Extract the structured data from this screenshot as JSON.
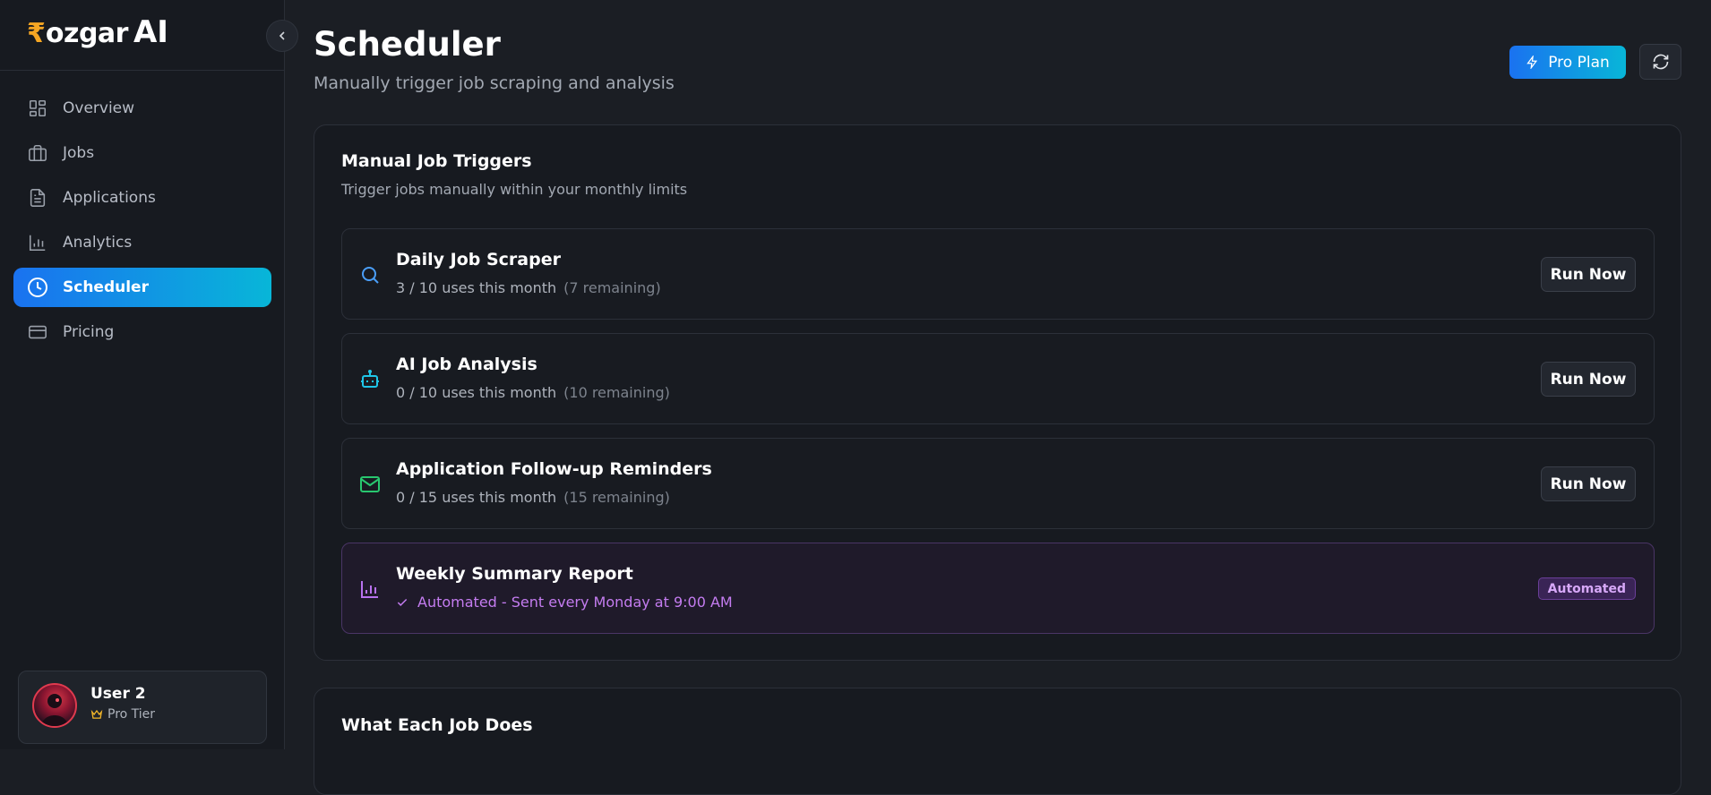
{
  "brand": {
    "rupee": "₹",
    "name": "ozgar",
    "ai": "AI"
  },
  "sidebar": {
    "items": [
      {
        "label": "Overview",
        "icon": "grid-icon",
        "active": false
      },
      {
        "label": "Jobs",
        "icon": "briefcase-icon",
        "active": false
      },
      {
        "label": "Applications",
        "icon": "document-icon",
        "active": false
      },
      {
        "label": "Analytics",
        "icon": "bar-chart-icon",
        "active": false
      },
      {
        "label": "Scheduler",
        "icon": "clock-icon",
        "active": true
      },
      {
        "label": "Pricing",
        "icon": "credit-card-icon",
        "active": false
      }
    ],
    "user": {
      "name": "User 2",
      "tier": "Pro Tier"
    }
  },
  "header": {
    "title": "Scheduler",
    "subtitle": "Manually trigger job scraping and analysis",
    "plan_label": "Pro Plan"
  },
  "triggers": {
    "title": "Manual Job Triggers",
    "subtitle": "Trigger jobs manually within your monthly limits",
    "jobs": [
      {
        "name": "Daily Job Scraper",
        "usage": "3 / 10 uses this month",
        "remaining": "(7 remaining)",
        "button": "Run Now",
        "icon": "search-icon",
        "color": "#4a9ef8"
      },
      {
        "name": "AI Job Analysis",
        "usage": "0 / 10 uses this month",
        "remaining": "(10 remaining)",
        "button": "Run Now",
        "icon": "robot-icon",
        "color": "#1fc6e8"
      },
      {
        "name": "Application Follow-up Reminders",
        "usage": "0 / 15 uses this month",
        "remaining": "(15 remaining)",
        "button": "Run Now",
        "icon": "mail-icon",
        "color": "#28c76f"
      }
    ],
    "weekly": {
      "name": "Weekly Summary Report",
      "status": "Automated - Sent every Monday at 9:00 AM",
      "badge": "Automated",
      "icon": "bar-chart-icon",
      "color": "#b872ee"
    }
  },
  "info": {
    "title": "What Each Job Does"
  },
  "colors": {
    "accent_start": "#1a72f0",
    "accent_end": "#08b6d8",
    "automated": "#c47cf0"
  }
}
